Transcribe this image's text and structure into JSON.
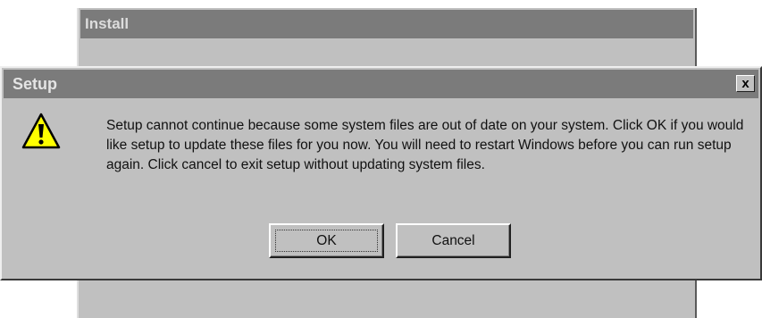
{
  "background_window": {
    "title": "Install"
  },
  "dialog": {
    "title": "Setup",
    "close_label": "x",
    "icon": "warning-exclamation-icon",
    "message": "Setup cannot continue because some system files are out of date on your system.  Click OK if you would like setup to update these files for you now.  You will need to restart Windows before you can run setup again.  Click cancel to exit setup without updating system files.",
    "buttons": {
      "ok_label": "OK",
      "cancel_label": "Cancel"
    }
  },
  "colors": {
    "face": "#c0c0c0",
    "titlebar_inactive": "#7b7b7b",
    "warning_yellow": "#ffff00"
  }
}
